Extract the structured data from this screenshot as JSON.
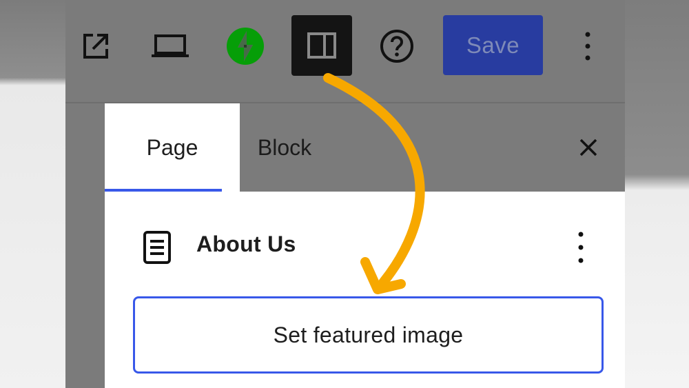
{
  "toolbar": {
    "icons": {
      "external": "external-link-icon",
      "preview": "laptop-icon",
      "jetpack": "jetpack-bolt-icon",
      "settings": "sidebar-toggle-icon",
      "help": "help-icon",
      "more": "more-vertical-icon"
    },
    "save_label": "Save"
  },
  "panel": {
    "tabs": [
      {
        "label": "Page",
        "active": true
      },
      {
        "label": "Block",
        "active": false
      }
    ],
    "document": {
      "title": "About Us",
      "icon": "page-icon"
    },
    "featured_image_label": "Set featured image"
  },
  "colors": {
    "accent": "#3858e9",
    "save_bg": "#283ca0",
    "jetpack_green": "#069e08",
    "arrow": "#f7a800",
    "settings_active_bg": "#141414"
  }
}
